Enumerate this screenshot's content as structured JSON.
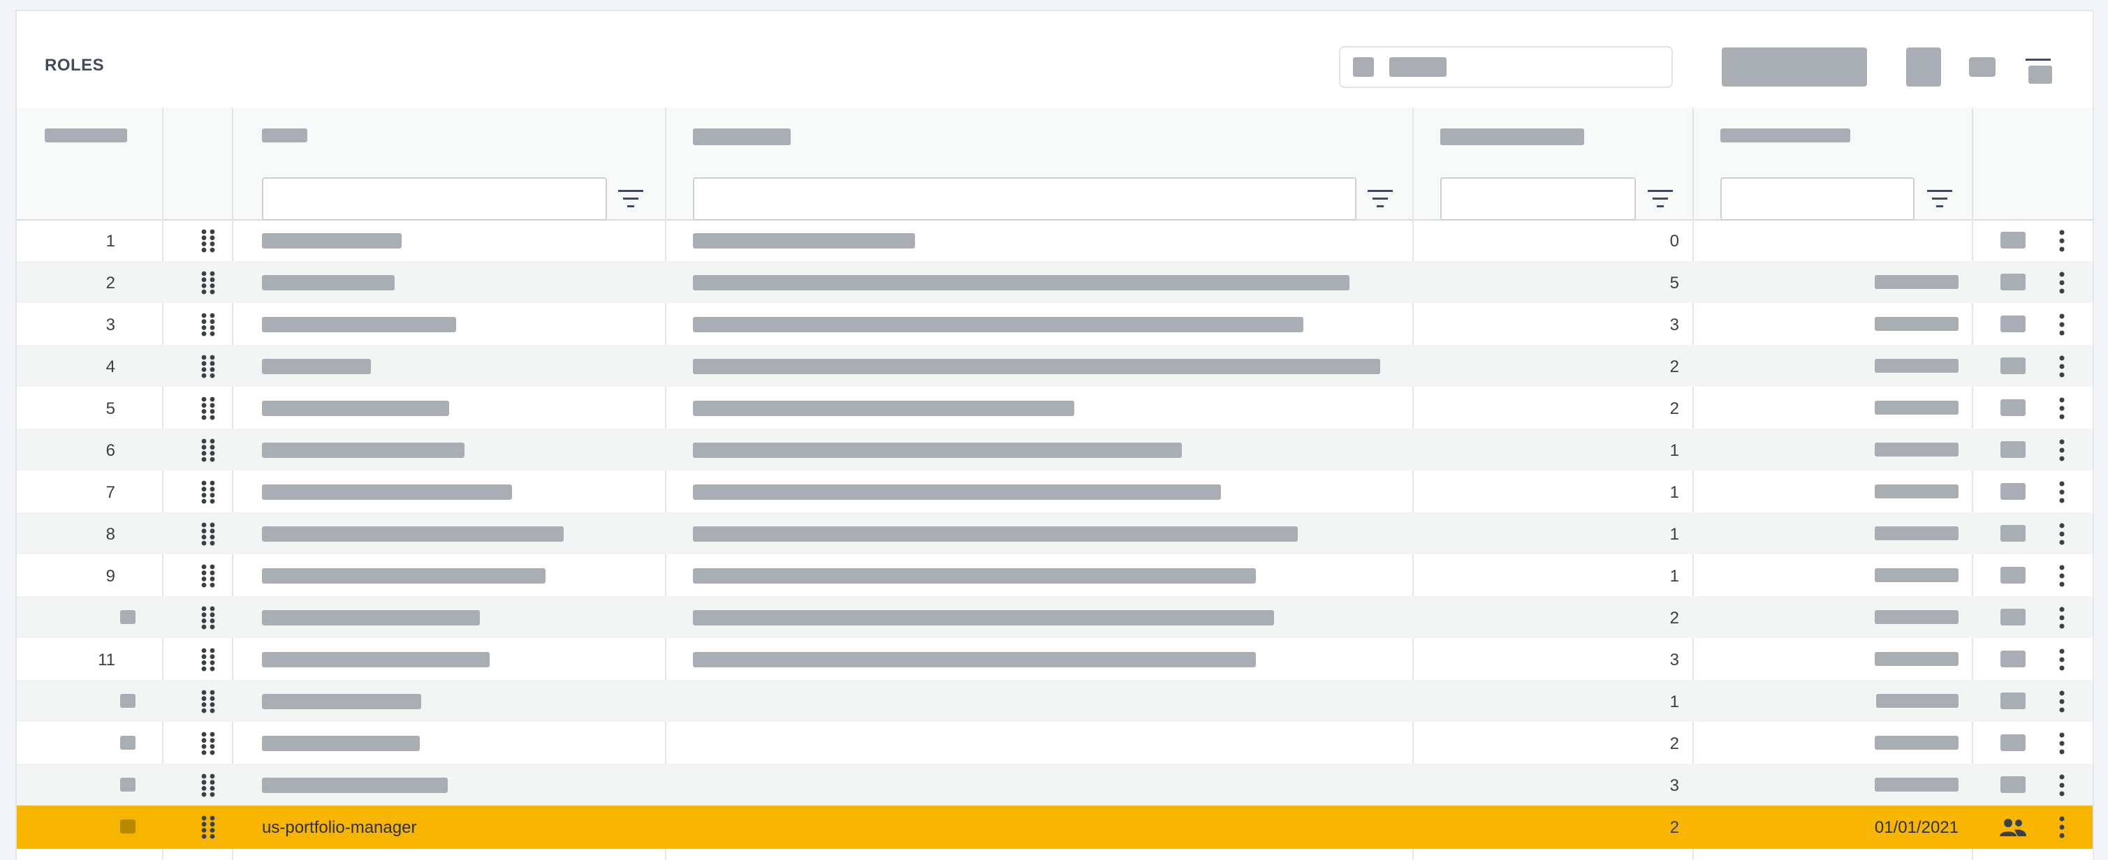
{
  "page": {
    "title": "ROLES"
  },
  "toolbar": {
    "search_icon": "search-icon",
    "sort_icon": "sort-lines-icon"
  },
  "filters": {
    "icon": "filter-icon",
    "name": "",
    "description": "",
    "count": "",
    "date": ""
  },
  "rows": [
    {
      "index": "1",
      "count": "0"
    },
    {
      "index": "2",
      "count": "5"
    },
    {
      "index": "3",
      "count": "3"
    },
    {
      "index": "4",
      "count": "2"
    },
    {
      "index": "5",
      "count": "2"
    },
    {
      "index": "6",
      "count": "1"
    },
    {
      "index": "7",
      "count": "1"
    },
    {
      "index": "8",
      "count": "1"
    },
    {
      "index": "9",
      "count": "1"
    },
    {
      "index": "",
      "count": "2"
    },
    {
      "index": "11",
      "count": "3"
    },
    {
      "index": "",
      "count": "1"
    },
    {
      "index": "",
      "count": "2"
    },
    {
      "index": "",
      "count": "3"
    },
    {
      "index": "",
      "count": "2",
      "name": "us-portfolio-manager",
      "date": "01/01/2021",
      "selected": true
    }
  ],
  "icons": {
    "drag": "drag-handle-icon",
    "more": "more-vertical-icon",
    "people": "people-icon"
  },
  "colors": {
    "highlight": "#f7b500",
    "placeholder": "#a9aeb5",
    "alt_row": "#f3f4f4"
  }
}
